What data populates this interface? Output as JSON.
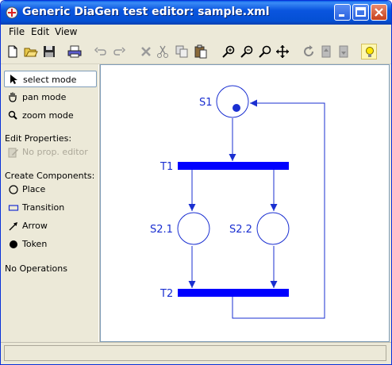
{
  "window": {
    "title": "Generic DiaGen test editor: sample.xml"
  },
  "menu": {
    "items": [
      "File",
      "Edit",
      "View"
    ]
  },
  "sidebar": {
    "modes": [
      {
        "label": "select mode",
        "icon": "arrow-pointer-icon",
        "selected": true
      },
      {
        "label": "pan mode",
        "icon": "hand-icon",
        "selected": false
      },
      {
        "label": "zoom mode",
        "icon": "magnifier-icon",
        "selected": false
      }
    ],
    "edit_properties_header": "Edit Properties:",
    "no_prop_editor": "No prop. editor",
    "create_components_header": "Create Components:",
    "components": [
      {
        "label": "Place",
        "icon": "circle-outline-icon"
      },
      {
        "label": "Transition",
        "icon": "rectangle-outline-icon"
      },
      {
        "label": "Arrow",
        "icon": "arrow-icon"
      },
      {
        "label": "Token",
        "icon": "filled-dot-icon"
      }
    ],
    "operations_text": "No Operations"
  },
  "diagram": {
    "places": [
      {
        "label": "S1",
        "has_token": true
      },
      {
        "label": "S2.1",
        "has_token": false
      },
      {
        "label": "S2.2",
        "has_token": false
      }
    ],
    "transitions": [
      {
        "label": "T1"
      },
      {
        "label": "T2"
      }
    ],
    "color": "#1a2fd1"
  },
  "colors": {
    "accent": "#0000ff",
    "titlebar": "#0a55df"
  }
}
